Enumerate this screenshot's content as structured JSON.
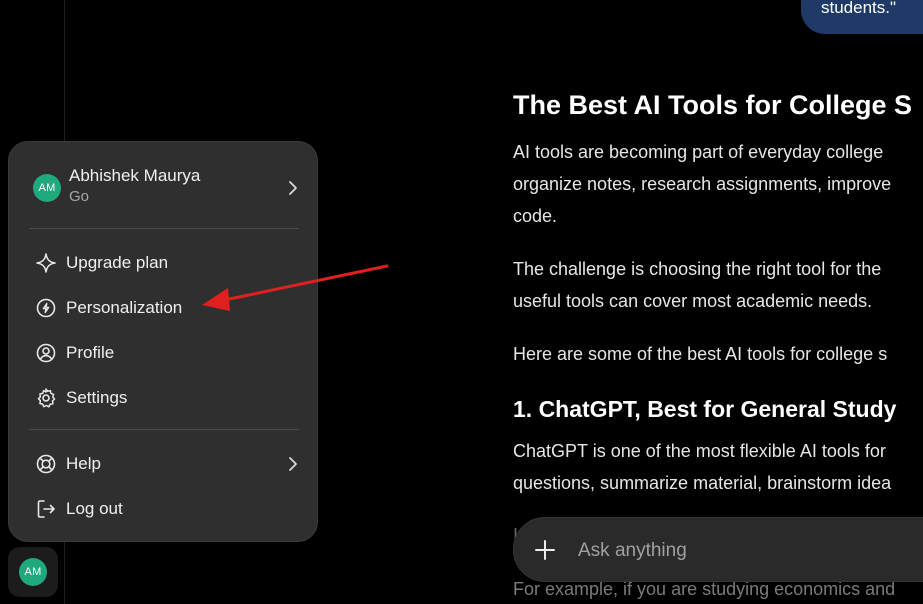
{
  "user_bubble_text": "students.\"",
  "article": {
    "title": "The Best AI Tools for College S",
    "p1": [
      "AI tools are becoming part of everyday college",
      "organize notes, research assignments, improve",
      "code."
    ],
    "p2": [
      "The challenge is choosing the right tool for the",
      "useful tools can cover most academic needs."
    ],
    "p3": "Here are some of the best AI tools for college s",
    "h2": "1. ChatGPT, Best for General Study",
    "p4": [
      "ChatGPT is one of the most flexible AI tools for",
      "questions, summarize material, brainstorm idea"
    ],
    "p5_partial": "I",
    "p6": "For example, if you are studying economics and"
  },
  "menu": {
    "user_name": "Abhishek Maurya",
    "user_plan": "Go",
    "avatar_initials": "AM",
    "items": [
      {
        "label": "Upgrade plan",
        "icon": "sparkle-icon"
      },
      {
        "label": "Personalization",
        "icon": "personalization-icon"
      },
      {
        "label": "Profile",
        "icon": "profile-icon"
      },
      {
        "label": "Settings",
        "icon": "gear-icon"
      },
      {
        "label": "Help",
        "icon": "lifebuoy-icon"
      },
      {
        "label": "Log out",
        "icon": "logout-icon"
      }
    ]
  },
  "composer": {
    "placeholder": "Ask anything"
  },
  "sidebar": {
    "avatar_initials": "AM"
  },
  "colors": {
    "background": "#000000",
    "menu_bg": "#2f2f2f",
    "avatar": "#1fa97f",
    "user_bubble": "#1f3a66",
    "annotation_arrow": "#e0201f"
  }
}
